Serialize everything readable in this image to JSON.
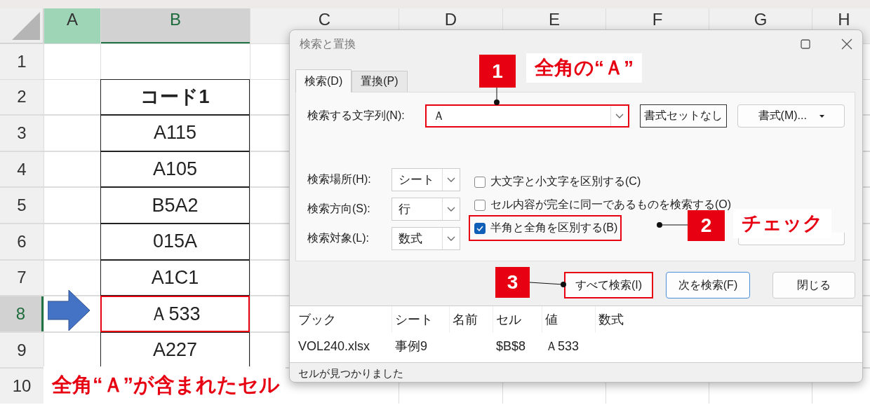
{
  "sheet": {
    "columns": [
      {
        "label": "A",
        "active": true,
        "selected": false
      },
      {
        "label": "B",
        "active": false,
        "selected": true
      },
      {
        "label": "C",
        "active": false,
        "selected": false
      },
      {
        "label": "D",
        "active": false,
        "selected": false
      },
      {
        "label": "E",
        "active": false,
        "selected": false
      },
      {
        "label": "F",
        "active": false,
        "selected": false
      },
      {
        "label": "G",
        "active": false,
        "selected": false
      },
      {
        "label": "H",
        "active": false,
        "selected": false
      }
    ],
    "rows": [
      {
        "label": "1",
        "selected": false
      },
      {
        "label": "2",
        "selected": false,
        "value": "コード1",
        "kind": "header"
      },
      {
        "label": "3",
        "selected": false,
        "value": "A115",
        "kind": "data"
      },
      {
        "label": "4",
        "selected": false,
        "value": "A105",
        "kind": "data"
      },
      {
        "label": "5",
        "selected": false,
        "value": "B5A2",
        "kind": "data"
      },
      {
        "label": "6",
        "selected": false,
        "value": "015A",
        "kind": "data"
      },
      {
        "label": "7",
        "selected": false,
        "value": "A1C1",
        "kind": "data"
      },
      {
        "label": "8",
        "selected": true,
        "value": "Ａ533",
        "kind": "data",
        "marked": true
      },
      {
        "label": "9",
        "selected": false,
        "value": "A227",
        "kind": "data"
      },
      {
        "label": "10",
        "selected": false
      }
    ]
  },
  "dialog": {
    "title": "検索と置換",
    "tabs": [
      {
        "label": "検索(D)",
        "selected": true
      },
      {
        "label": "置換(P)",
        "selected": false
      }
    ],
    "find_what": {
      "label": "検索する文字列(N):",
      "value": "Ａ",
      "marked": true
    },
    "no_format_button": "書式セットなし",
    "format_button": "書式(M)...",
    "selects": [
      {
        "label": "検索場所(H):",
        "value": "シート"
      },
      {
        "label": "検索方向(S):",
        "value": "行"
      },
      {
        "label": "検索対象(L):",
        "value": "数式"
      }
    ],
    "checkboxes": [
      {
        "label": "大文字と小文字を区別する(C)",
        "checked": false,
        "marked": false
      },
      {
        "label": "セル内容が完全に同一であるものを検索する(O)",
        "checked": false,
        "marked": false
      },
      {
        "label": "半角と全角を区別する(B)",
        "checked": true,
        "marked": true
      }
    ],
    "buttons": [
      {
        "label": "すべて検索(I)",
        "default": false,
        "marked": true
      },
      {
        "label": "次を検索(F)",
        "default": true,
        "marked": false
      },
      {
        "label": "閉じる",
        "default": false,
        "marked": false
      }
    ],
    "results": {
      "columns": [
        "ブック",
        "シート",
        "名前",
        "セル",
        "値",
        "数式"
      ],
      "rows": [
        [
          "VOL240.xlsx",
          "事例9",
          "",
          "$B$8",
          "Ａ533",
          ""
        ]
      ]
    },
    "status": "セルが見つかりました"
  },
  "callouts": [
    {
      "number": "1",
      "label": "全角の“Ａ”"
    },
    {
      "number": "2",
      "label": "チェック"
    },
    {
      "number": "3"
    }
  ],
  "caption": "全角“Ａ”が含まれたセル"
}
